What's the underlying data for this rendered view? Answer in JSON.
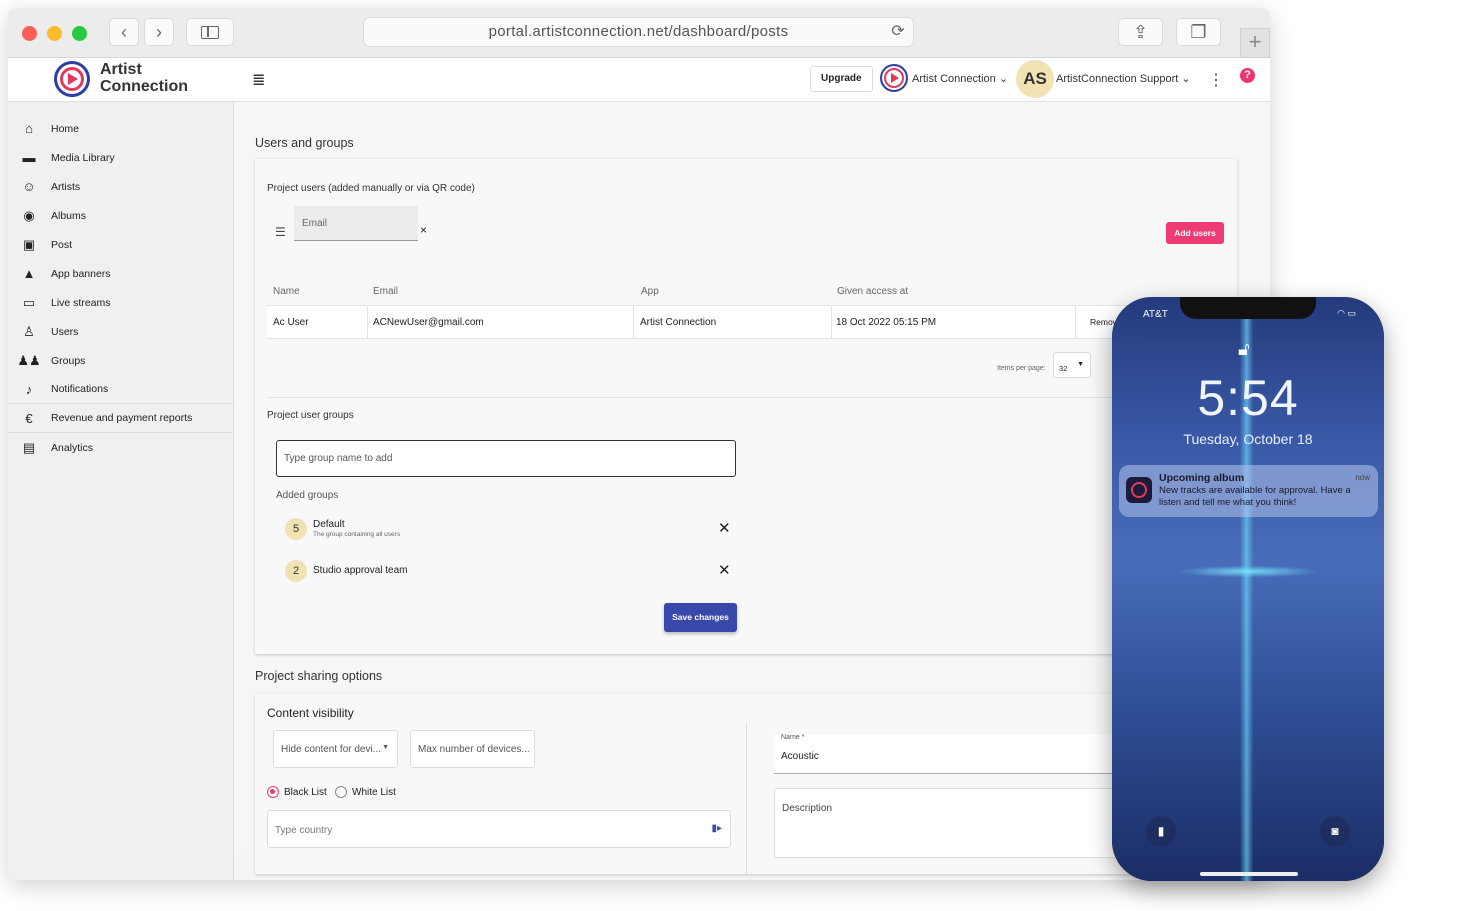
{
  "browser": {
    "url": "portal.artistconnection.net/dashboard/posts"
  },
  "header": {
    "logo_line1": "Artist",
    "logo_line2": "Connection",
    "upgrade_label": "Upgrade",
    "project_name": "Artist Connection",
    "avatar_initials": "AS",
    "user_name": "ArtistConnection Support",
    "help_label": "?"
  },
  "sidebar": {
    "items": [
      {
        "label": "Home",
        "icon": "home-icon"
      },
      {
        "label": "Media Library",
        "icon": "folder-icon"
      },
      {
        "label": "Artists",
        "icon": "face-icon"
      },
      {
        "label": "Albums",
        "icon": "album-icon"
      },
      {
        "label": "Post",
        "icon": "library-icon"
      },
      {
        "label": "App banners",
        "icon": "rocket-icon"
      },
      {
        "label": "Live streams",
        "icon": "monitor-icon"
      },
      {
        "label": "Users",
        "icon": "person-icon"
      },
      {
        "label": "Groups",
        "icon": "people-icon"
      },
      {
        "label": "Notifications",
        "icon": "bell-icon"
      },
      {
        "label": "Revenue and payment reports",
        "icon": "euro-icon"
      },
      {
        "label": "Analytics",
        "icon": "analytics-icon"
      }
    ]
  },
  "users": {
    "section_title": "Users and groups",
    "card_title": "Project users (added manually or via QR code)",
    "email_placeholder": "Email",
    "add_users_label": "Add users",
    "columns": [
      "Name",
      "Email",
      "App",
      "Given access at"
    ],
    "rows": [
      {
        "name": "Ac User",
        "email": "ACNewUser@gmail.com",
        "app": "Artist Connection",
        "given_access": "18 Oct 2022 05:15 PM",
        "action": "Remove"
      }
    ],
    "items_per_page_label": "Items per page:",
    "items_per_page_value": "32"
  },
  "groups": {
    "title": "Project user groups",
    "input_placeholder": "Type group name to add",
    "added_label": "Added groups",
    "items": [
      {
        "count": "5",
        "name": "Default",
        "description": "The group containing all users"
      },
      {
        "count": "2",
        "name": "Studio approval team",
        "description": ""
      }
    ],
    "save_label": "Save changes"
  },
  "sharing": {
    "section_title": "Project sharing options",
    "visibility_title": "Content visibility",
    "hide_select": "Hide content for devi...",
    "max_devices": "Max number of devices...",
    "radio_black": "Black List",
    "radio_white": "White List",
    "country_placeholder": "Type country",
    "name_label": "Name *",
    "name_value": "Acoustic",
    "description_label": "Description"
  },
  "phone": {
    "carrier": "AT&T",
    "time": "5:54",
    "date": "Tuesday, October 18",
    "notification": {
      "title": "Upcoming album",
      "time": "now",
      "body": "New tracks are available for approval. Have a listen and tell me what you think!"
    }
  }
}
